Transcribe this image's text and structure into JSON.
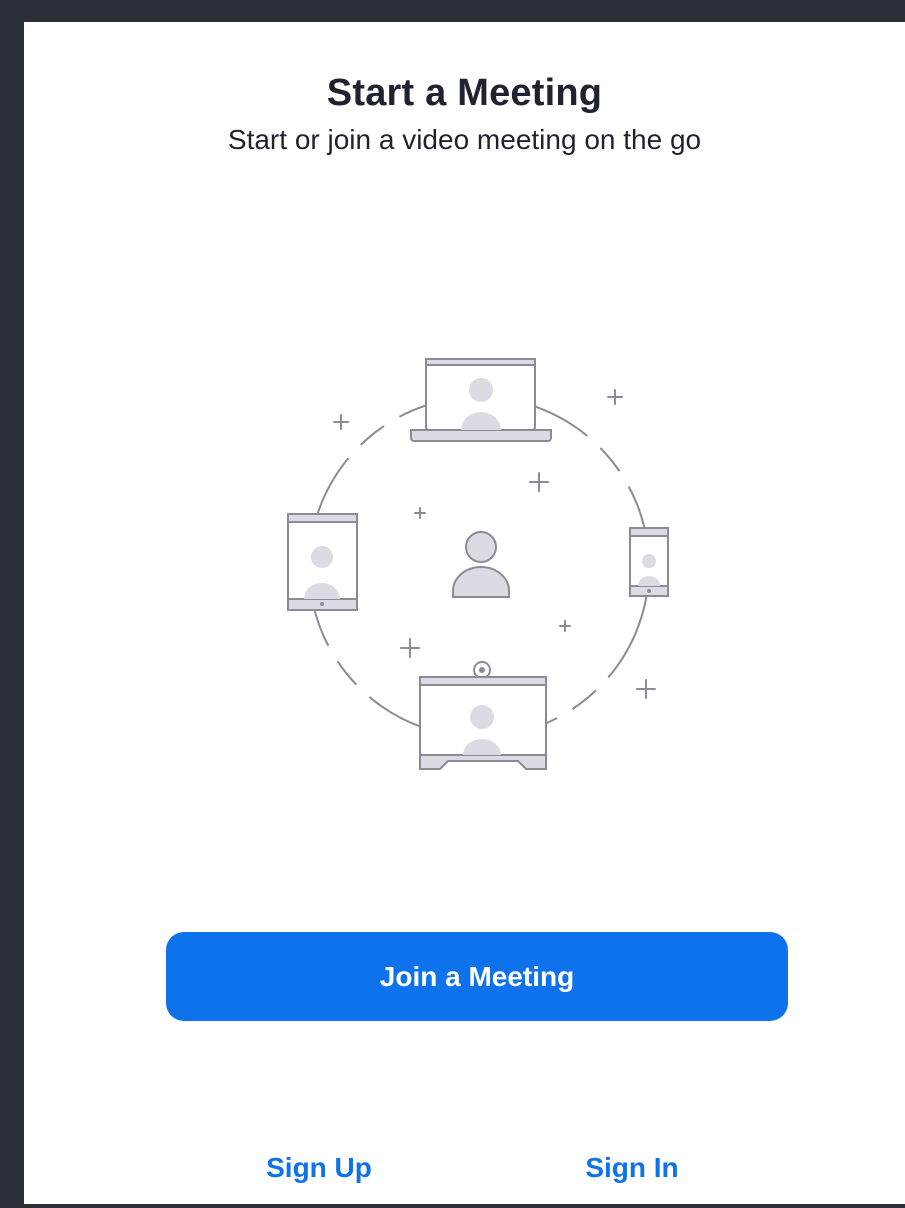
{
  "header": {
    "title": "Start a Meeting",
    "subtitle": "Start or join a video meeting on the go"
  },
  "illustration": {
    "icons": [
      "laptop-icon",
      "tablet-icon",
      "phone-icon",
      "room-display-icon",
      "person-icon"
    ]
  },
  "actions": {
    "join_label": "Join a Meeting",
    "sign_up_label": "Sign Up",
    "sign_in_label": "Sign In"
  },
  "colors": {
    "accent": "#0e72ed",
    "text": "#1f2330",
    "frame": "#2b2f38",
    "illustration_stroke": "#8a8b96",
    "illustration_fill": "#dcdbe3"
  }
}
